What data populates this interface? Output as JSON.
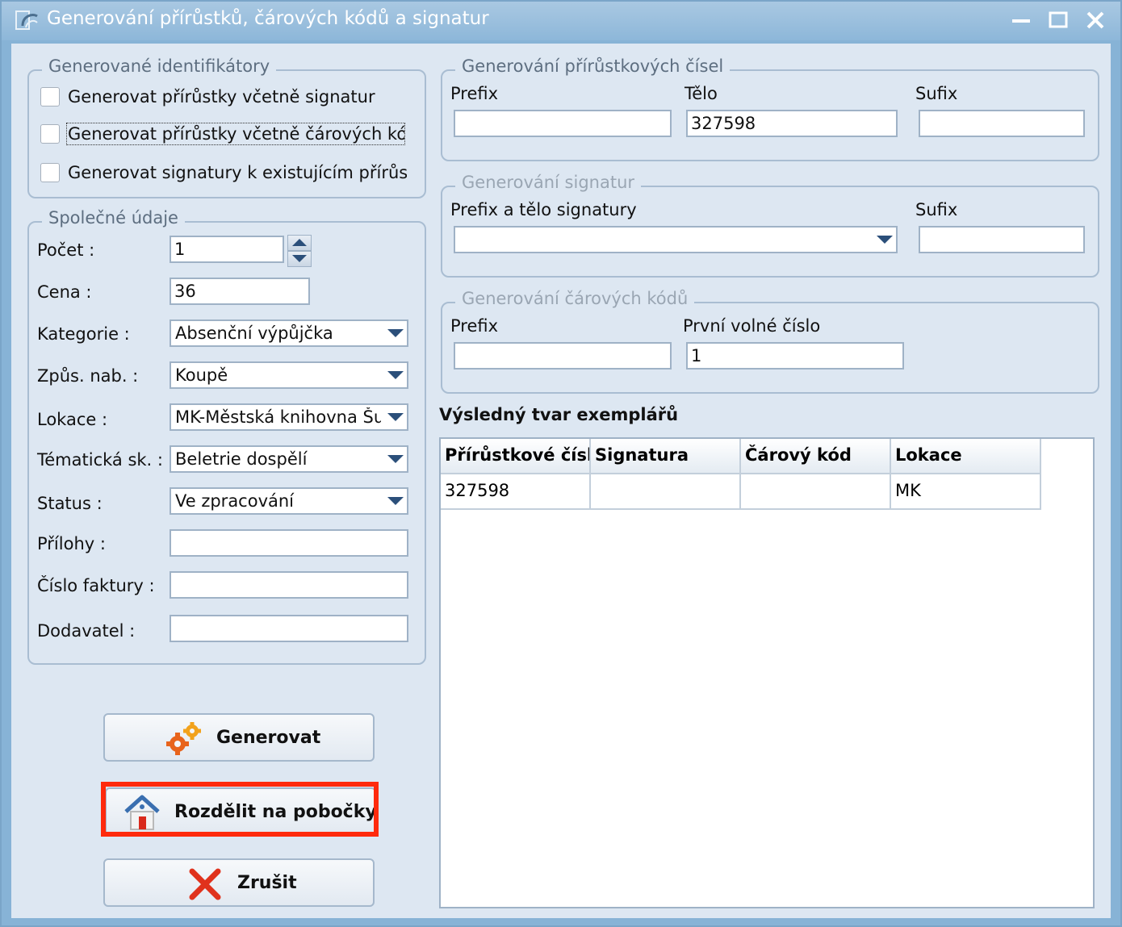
{
  "window": {
    "title": "Generování přírůstků, čárových kódů a signatur"
  },
  "identifiers": {
    "legend": "Generované identifikátory",
    "options": [
      {
        "label": "Generovat přírůstky včetně signatur",
        "checked": false
      },
      {
        "label": "Generovat přírůstky včetně čárových kódů",
        "checked": false
      },
      {
        "label": "Generovat signatury k existujícím přírůstkům",
        "checked": false
      }
    ]
  },
  "common": {
    "legend": "Společné údaje",
    "count_label": "Počet :",
    "count_value": "1",
    "price_label": "Cena :",
    "price_value": "36",
    "category_label": "Kategorie :",
    "category_value": "Absenční výpůjčka",
    "acquisition_label": "Způs. nab. :",
    "acquisition_value": "Koupě",
    "location_label": "Lokace :",
    "location_value": "MK-Městská knihovna Šumperk",
    "thematic_label": "Tématická sk. :",
    "thematic_value": "Beletrie dospělí",
    "status_label": "Status :",
    "status_value": "Ve zpracování",
    "attachments_label": "Přílohy :",
    "attachments_value": "",
    "invoice_label": "Číslo faktury :",
    "invoice_value": "",
    "supplier_label": "Dodavatel :",
    "supplier_value": ""
  },
  "accession": {
    "legend": "Generování přírůstkových čísel",
    "prefix_label": "Prefix",
    "prefix_value": "",
    "body_label": "Tělo",
    "body_value": "327598",
    "suffix_label": "Sufix",
    "suffix_value": ""
  },
  "signature": {
    "legend": "Generování signatur",
    "prefix_body_label": "Prefix a tělo signatury",
    "prefix_body_value": "",
    "suffix_label": "Sufix",
    "suffix_value": ""
  },
  "barcode": {
    "legend": "Generování čárových kódů",
    "prefix_label": "Prefix",
    "prefix_value": "",
    "first_free_label": "První volné číslo",
    "first_free_value": "1"
  },
  "result": {
    "title": "Výsledný tvar exemplářů",
    "columns": [
      "Přírůstkové číslo",
      "Signatura",
      "Čárový kód",
      "Lokace"
    ],
    "rows": [
      [
        "327598",
        "",
        "",
        "MK"
      ]
    ]
  },
  "buttons": {
    "generate": "Generovat",
    "split": "Rozdělit na pobočky",
    "cancel": "Zrušit"
  },
  "colors": {
    "highlight": "#ff2a0d",
    "title_bar": "#8db7d9",
    "client_bg": "#dde7f2"
  }
}
